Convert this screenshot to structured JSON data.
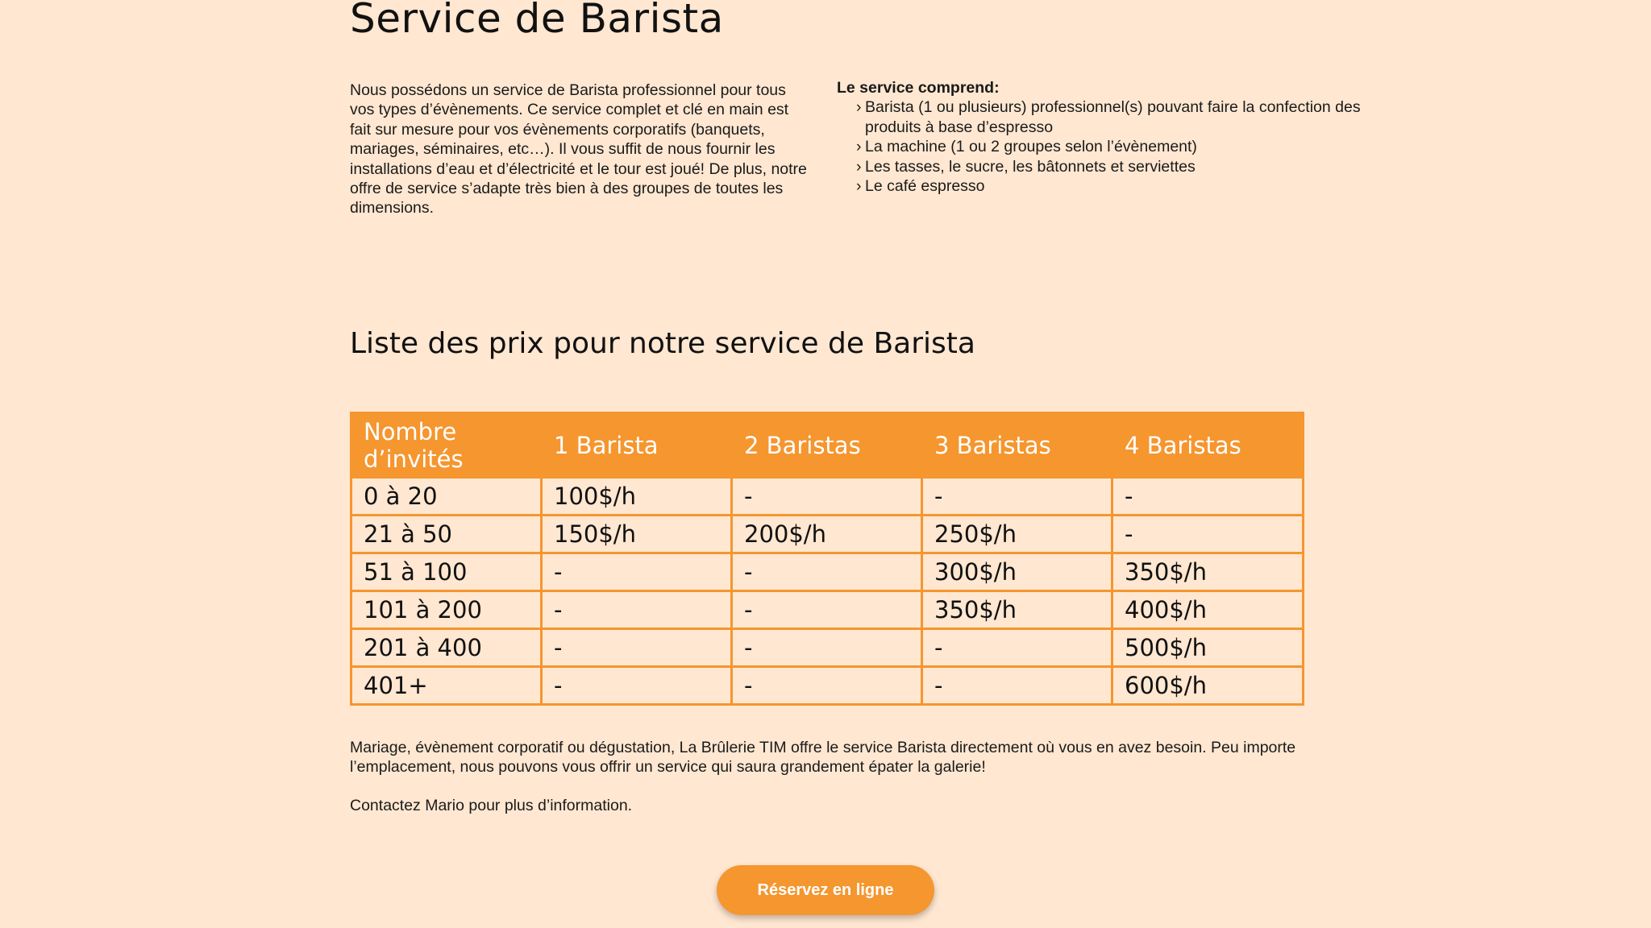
{
  "title": "Service de Barista",
  "intro": "Nous possédons un service de Barista professionnel pour tous vos types d’évènements. Ce service complet et clé en main est fait sur mesure pour vos évènements corporatifs (banquets, mariages, séminaires, etc…). Il vous suffit de nous fournir les installations d’eau et d’électricité et le tour est joué! De plus, notre offre de service s’adapte très bien à des groupes de toutes les dimensions.",
  "includes": {
    "heading": "Le service comprend:",
    "bullet": "›",
    "items": [
      "Barista (1 ou plusieurs) professionnel(s) pouvant faire la confection des produits à base d’espresso",
      "La machine (1 ou 2 groupes selon l’évènement)",
      "Les tasses, le sucre, les bâtonnets et serviettes",
      "Le café espresso"
    ]
  },
  "prices_title": "Liste des prix pour notre service de Barista",
  "table": {
    "headers": [
      "Nombre d’invités",
      "1 Barista",
      "2 Baristas",
      "3 Baristas",
      "4 Baristas"
    ],
    "rows": [
      [
        "0 à 20",
        "100$/h",
        "-",
        "-",
        "-"
      ],
      [
        "21 à 50",
        "150$/h",
        "200$/h",
        "250$/h",
        "-"
      ],
      [
        "51 à 100",
        "-",
        "-",
        "300$/h",
        "350$/h"
      ],
      [
        "101 à 200",
        "-",
        "-",
        "350$/h",
        "400$/h"
      ],
      [
        "201 à 400",
        "-",
        "-",
        "-",
        "500$/h"
      ],
      [
        "401+",
        "-",
        "-",
        "-",
        "600$/h"
      ]
    ]
  },
  "outro": "Mariage, évènement corporatif ou dégustation, La Brûlerie TIM offre le service Barista directement où vous en avez besoin. Peu importe l’emplacement, nous pouvons vous offrir un service qui saura grandement épater la galerie!",
  "contact": "Contactez Mario pour plus d’information.",
  "reserve_button": "Réservez en ligne",
  "colors": {
    "background": "#ffe7d1",
    "accent": "#f5962f"
  }
}
